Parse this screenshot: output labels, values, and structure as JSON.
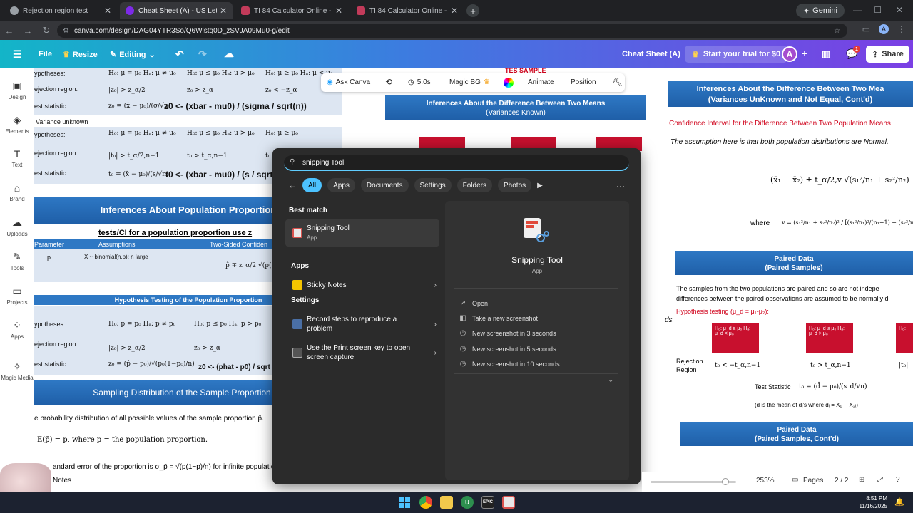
{
  "tabs": [
    {
      "title": "Rejection region test",
      "active": false,
      "color": "#bdc1c6"
    },
    {
      "title": "Cheat Sheet (A) - US Letter",
      "active": true,
      "color": "#7d2ae8"
    },
    {
      "title": "TI 84 Calculator Online - Free O",
      "active": false,
      "color": "#c23b5a"
    },
    {
      "title": "TI 84 Calculator Online - Free O",
      "active": false,
      "color": "#c23b5a"
    }
  ],
  "browser": {
    "url": "canva.com/design/DAG04YTR3So/Q6Wlstq0D_zSVJA09Mu0-g/edit",
    "gemini_label": "Gemini",
    "profile_initial": "A"
  },
  "canva": {
    "file_label": "File",
    "resize_label": "Resize",
    "editing_label": "Editing",
    "doc_title": "Cheat Sheet (A)",
    "trial_label": "Start your trial for $0",
    "avatar_initial": "A",
    "notif_count": "1",
    "share_label": "Share"
  },
  "sidebar": [
    {
      "label": "Design",
      "icon": "design-icon"
    },
    {
      "label": "Elements",
      "icon": "elements-icon"
    },
    {
      "label": "Text",
      "icon": "text-icon"
    },
    {
      "label": "Brand",
      "icon": "brand-icon"
    },
    {
      "label": "Uploads",
      "icon": "uploads-icon"
    },
    {
      "label": "Tools",
      "icon": "tools-icon"
    },
    {
      "label": "Projects",
      "icon": "projects-icon"
    },
    {
      "label": "Apps",
      "icon": "apps-icon"
    },
    {
      "label": "Magic Media",
      "icon": "magic-media-icon"
    }
  ],
  "context_bar": {
    "ask_canva": "Ask Canva",
    "duration": "5.0s",
    "magic_bg": "Magic BG",
    "animate": "Animate",
    "position": "Position"
  },
  "left_page": {
    "mean_rows": [
      {
        "label": "ypotheses:",
        "c1": "H₀: μ = μ₀   Hₐ: μ ≠ μ₀",
        "c2": "H₀: μ ≤ μ₀   Hₐ: μ > μ₀",
        "c3": "H₀: μ ≥ μ₀   Hₐ: μ < μ₀"
      },
      {
        "label": "ejection region:",
        "c1": "|z₀| > z_α/2",
        "c2": "z₀ > z_α",
        "c3": "z₀ < −z_α"
      },
      {
        "label": "est statistic:",
        "c1": "z₀ = (x̄ − μ₀)/(σ/√n)",
        "c2": "",
        "c3": ""
      }
    ],
    "z_code": "z0 <- (xbar - mu0) / (sigma / sqrt(n))",
    "variance_unknown": "Variance unknown",
    "unknown_rows": [
      {
        "label": "ypotheses:",
        "c1": "H₀: μ = μ₀   Hₐ: μ ≠ μ₀",
        "c2": "H₀: μ ≤ μ₀   Hₐ: μ > μ₀",
        "c3": "H₀: μ ≥ μ₀"
      },
      {
        "label": "ejection region:",
        "c1": "|t₀| > t_α/2,n−1",
        "c2": "t₀ > t_α,n−1",
        "c3": "t₀ <"
      },
      {
        "label": "est statistic:",
        "c1": "t₀ = (x̄ − μ₀)/(s/√n)",
        "c2": "",
        "c3": ""
      }
    ],
    "t_code": "t0 <- (xbar - mu0) / (s / sqrt",
    "proportion_banner": "Inferences About Population Proportion",
    "tests_ci": "tests/CI for a population proportion use z",
    "prop_table_headers": [
      "Parameter",
      "Assumptions",
      "Two-Sided Confiden"
    ],
    "prop_table_row": [
      "p",
      "X ~ binomial(n,p); n large",
      "p̂ ∓ z_α/2 √(p(1"
    ],
    "hyp_prop_banner": "Hypothesis Testing of the Population Proportion",
    "prop_rows": [
      {
        "label": "ypotheses:",
        "c1": "H₀: p = p₀   Hₐ: p ≠ p₀",
        "c2": "H₀: p ≤ p₀   Hₐ: p > p₀"
      },
      {
        "label": "ejection region:",
        "c1": "|z₀| > z_α/2",
        "c2": "z₀ > z_α"
      },
      {
        "label": "est statistic:",
        "c1": "z₀ = (p̂ − p₀)/√(p₀(1−p₀)/n)",
        "c2": ""
      }
    ],
    "phat_code": "z0 <- (phat - p0) / sqrt",
    "sampling_banner": "Sampling Distribution of the Sample Proportion (p̄)",
    "prob_dist": "e probability distribution of all possible values of the sample proportion p̄.",
    "expectation": "E(p̄) = p, where p = the population proportion.",
    "std_error": "andard error of the proportion is σ_p̄ = √(p(1−p)/n) for infinite populatio",
    "notes_label": "Notes"
  },
  "mid_page": {
    "banner_title": "Inferences About the Difference Between Two Means",
    "banner_sub": "(Variances Known)",
    "top_fragment": "TES SAMPLE",
    "side_fragment": "ds."
  },
  "right_page": {
    "banner1_title": "Inferences About the Difference Between Two Mea",
    "banner1_sub": "(Variances UnKnown and Not Equal, Cont'd)",
    "ci_line": "Confidence Interval for the Difference Between Two Population Means",
    "assumption": "The assumption here is that both population distributions are Normal.",
    "ci_formula": "(x̄₁ − x̄₂) ± t_α/2,v √(s₁²/n₁ + s₂²/n₂)",
    "where": "where",
    "v_formula": "v = (s₁²/n₁ + s₂²/n₂)² / [(s₁²/n₁)²/(n₁−1) + (s₂²/n₂)²/(n₂−1)]",
    "paired_title": "Paired Data",
    "paired_sub": "(Paired Samples)",
    "paired_text_1": "The samples from the two populations are paired and so are not indepe",
    "paired_text_2": "differences between the paired observations are assumed to be normally di",
    "hyp_testing": "Hypothesis testing (μ_d = μ₁-μ₂):",
    "red_boxes": [
      "H₀: μ_d ≥ μ₀  Hₐ: μ_d < μ₀",
      "H₀: μ_d ≤ μ₀  Hₐ: μ_d > μ₀",
      "H₀:"
    ],
    "rejection_label_1": "Rejection",
    "rejection_label_2": "Region",
    "rej_1": "t₀ < −t_α,n−1",
    "rej_2": "t₀ > t_α,n−1",
    "rej_3": "|t₀|",
    "test_statistic_label": "Test Statistic",
    "test_statistic": "t₀ = (d̄ − μ₀)/(s_d/√n)",
    "dbar_note": "(d̄ is the mean of dᵢ's  where dᵢ = X₁ᵢ − X₂ᵢ)",
    "paired2_title": "Paired Data",
    "paired2_sub": "(Paired Samples, Cont'd)"
  },
  "start_menu": {
    "query": "snipping Tool",
    "filters": [
      "All",
      "Apps",
      "Documents",
      "Settings",
      "Folders",
      "Photos"
    ],
    "best_match_header": "Best match",
    "best_match": {
      "name": "Snipping Tool",
      "type": "App"
    },
    "apps_header": "Apps",
    "apps": [
      {
        "name": "Sticky Notes"
      }
    ],
    "settings_header": "Settings",
    "settings": [
      {
        "line1": "Record steps to reproduce a",
        "line2": "problem"
      },
      {
        "line1": "Use the Print screen key to open",
        "line2": "screen capture"
      }
    ],
    "detail": {
      "name": "Snipping Tool",
      "type": "App",
      "actions": [
        "Open",
        "Take a new screenshot",
        "New screenshot in 3 seconds",
        "New screenshot in 5 seconds",
        "New screenshot in 10 seconds"
      ]
    }
  },
  "footer": {
    "zoom": "253%",
    "pages_label": "Pages",
    "page_count": "2 / 2"
  },
  "taskbar": {
    "time": "8:51 PM",
    "date": "11/16/2025",
    "epic_label": "EPIC"
  }
}
